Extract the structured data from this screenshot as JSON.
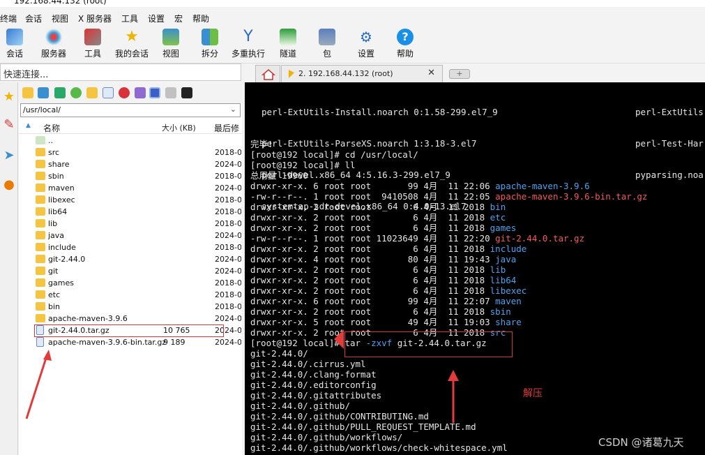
{
  "window": {
    "title": "192.168.44.132 (root)"
  },
  "menu": [
    "终端",
    "会话",
    "视图",
    "X 服务器",
    "工具",
    "设置",
    "宏",
    "帮助"
  ],
  "toolbar": [
    {
      "label": "会话",
      "icon": "session-icon"
    },
    {
      "label": "服务器",
      "icon": "servers-icon"
    },
    {
      "label": "工具",
      "icon": "tools-icon"
    },
    {
      "label": "我的会话",
      "icon": "star-icon"
    },
    {
      "label": "视图",
      "icon": "view-icon"
    },
    {
      "label": "拆分",
      "icon": "split-icon"
    },
    {
      "label": "多重执行",
      "icon": "multiexec-icon"
    },
    {
      "label": "隧道",
      "icon": "tunnel-icon"
    },
    {
      "label": "包",
      "icon": "package-icon"
    },
    {
      "label": "设置",
      "icon": "settings-icon"
    },
    {
      "label": "帮助",
      "icon": "help-icon"
    }
  ],
  "quick_connect": {
    "placeholder": "快速连接..."
  },
  "tabs": {
    "session_label": "2. 192.168.44.132 (root)",
    "close": "✕",
    "new": "+"
  },
  "sftp": {
    "path": "/usr/local/",
    "columns": {
      "name": "名称",
      "size": "大小 (KB)",
      "modified": "最后修"
    },
    "files": [
      {
        "name": "..",
        "size": "",
        "date": "",
        "type": "up"
      },
      {
        "name": "src",
        "size": "",
        "date": "2018-0",
        "type": "dir"
      },
      {
        "name": "share",
        "size": "",
        "date": "2024-0",
        "type": "dir"
      },
      {
        "name": "sbin",
        "size": "",
        "date": "2018-0",
        "type": "dir"
      },
      {
        "name": "maven",
        "size": "",
        "date": "2024-0",
        "type": "dir"
      },
      {
        "name": "libexec",
        "size": "",
        "date": "2018-0",
        "type": "dir"
      },
      {
        "name": "lib64",
        "size": "",
        "date": "2018-0",
        "type": "dir"
      },
      {
        "name": "lib",
        "size": "",
        "date": "2018-0",
        "type": "dir"
      },
      {
        "name": "java",
        "size": "",
        "date": "2024-0",
        "type": "dir"
      },
      {
        "name": "include",
        "size": "",
        "date": "2018-0",
        "type": "dir"
      },
      {
        "name": "git-2.44.0",
        "size": "",
        "date": "2024-0",
        "type": "dir"
      },
      {
        "name": "git",
        "size": "",
        "date": "2024-0",
        "type": "dir"
      },
      {
        "name": "games",
        "size": "",
        "date": "2018-0",
        "type": "dir"
      },
      {
        "name": "etc",
        "size": "",
        "date": "2018-0",
        "type": "dir"
      },
      {
        "name": "bin",
        "size": "",
        "date": "2018-0",
        "type": "dir"
      },
      {
        "name": "apache-maven-3.9.6",
        "size": "",
        "date": "2024-0",
        "type": "dir"
      },
      {
        "name": "git-2.44.0.tar.gz",
        "size": "10 765",
        "date": "2024-0",
        "type": "file"
      },
      {
        "name": "apache-maven-3.9.6-bin.tar.gz",
        "size": "9 189",
        "date": "2024-0",
        "type": "file"
      }
    ]
  },
  "terminal": {
    "top_left": [
      "perl-ExtUtils-Install.noarch 0:1.58-299.el7_9",
      "perl-ExtUtils-ParseXS.noarch 1:3.18-3.el7",
      "perl-devel.x86_64 4:5.16.3-299.el7_9",
      "systemtap-sdt-devel.x86_64 0:4.0-13.el7"
    ],
    "top_right": [
      "perl-ExtUtils",
      "perl-Test-Har",
      "pyparsing.noa"
    ],
    "done": "完毕!",
    "prompt1": "[root@192 local]# cd /usr/local/",
    "prompt2": "[root@192 local]# ll",
    "total": "总用量 19960",
    "ls": [
      {
        "meta": "drwxr-xr-x. 6 root root       99 4月  11 22:06 ",
        "name": "apache-maven-3.9.6",
        "color": "blue"
      },
      {
        "meta": "-rw-r--r--. 1 root root  9410508 4月  11 22:05 ",
        "name": "apache-maven-3.9.6-bin.tar.gz",
        "color": "red"
      },
      {
        "meta": "drwxr-xr-x. 2 root root        6 4月  11 2018 ",
        "name": "bin",
        "color": "blue"
      },
      {
        "meta": "drwxr-xr-x. 2 root root        6 4月  11 2018 ",
        "name": "etc",
        "color": "blue"
      },
      {
        "meta": "drwxr-xr-x. 2 root root        6 4月  11 2018 ",
        "name": "games",
        "color": "blue"
      },
      {
        "meta": "-rw-r--r--. 1 root root 11023649 4月  11 22:20 ",
        "name": "git-2.44.0.tar.gz",
        "color": "red"
      },
      {
        "meta": "drwxr-xr-x. 2 root root        6 4月  11 2018 ",
        "name": "include",
        "color": "blue"
      },
      {
        "meta": "drwxr-xr-x. 4 root root       80 4月  11 19:43 ",
        "name": "java",
        "color": "blue"
      },
      {
        "meta": "drwxr-xr-x. 2 root root        6 4月  11 2018 ",
        "name": "lib",
        "color": "blue"
      },
      {
        "meta": "drwxr-xr-x. 2 root root        6 4月  11 2018 ",
        "name": "lib64",
        "color": "blue"
      },
      {
        "meta": "drwxr-xr-x. 2 root root        6 4月  11 2018 ",
        "name": "libexec",
        "color": "blue"
      },
      {
        "meta": "drwxr-xr-x. 6 root root       99 4月  11 22:07 ",
        "name": "maven",
        "color": "blue"
      },
      {
        "meta": "drwxr-xr-x. 2 root root        6 4月  11 2018 ",
        "name": "sbin",
        "color": "blue"
      },
      {
        "meta": "drwxr-xr-x. 5 root root       49 4月  11 19:03 ",
        "name": "share",
        "color": "blue"
      },
      {
        "meta": "drwxr-xr-x. 2 root root        6 4月  11 2018 ",
        "name": "src",
        "color": "blue"
      }
    ],
    "prompt3_prefix": "[root@192 local]# ",
    "prompt3_cmd": "tar ",
    "prompt3_flag": "-zxvf",
    "prompt3_arg": " git-2.44.0.tar.gz",
    "output": [
      "git-2.44.0/",
      "git-2.44.0/.cirrus.yml",
      "git-2.44.0/.clang-format",
      "git-2.44.0/.editorconfig",
      "git-2.44.0/.gitattributes",
      "git-2.44.0/.github/",
      "git-2.44.0/.github/CONTRIBUTING.md",
      "git-2.44.0/.github/PULL_REQUEST_TEMPLATE.md",
      "git-2.44.0/.github/workflows/",
      "git-2.44.0/.github/workflows/check-whitespace.yml"
    ]
  },
  "annotation": {
    "label": "解压",
    "color": "#e23b3b"
  },
  "watermark": "CSDN @诸葛九天"
}
